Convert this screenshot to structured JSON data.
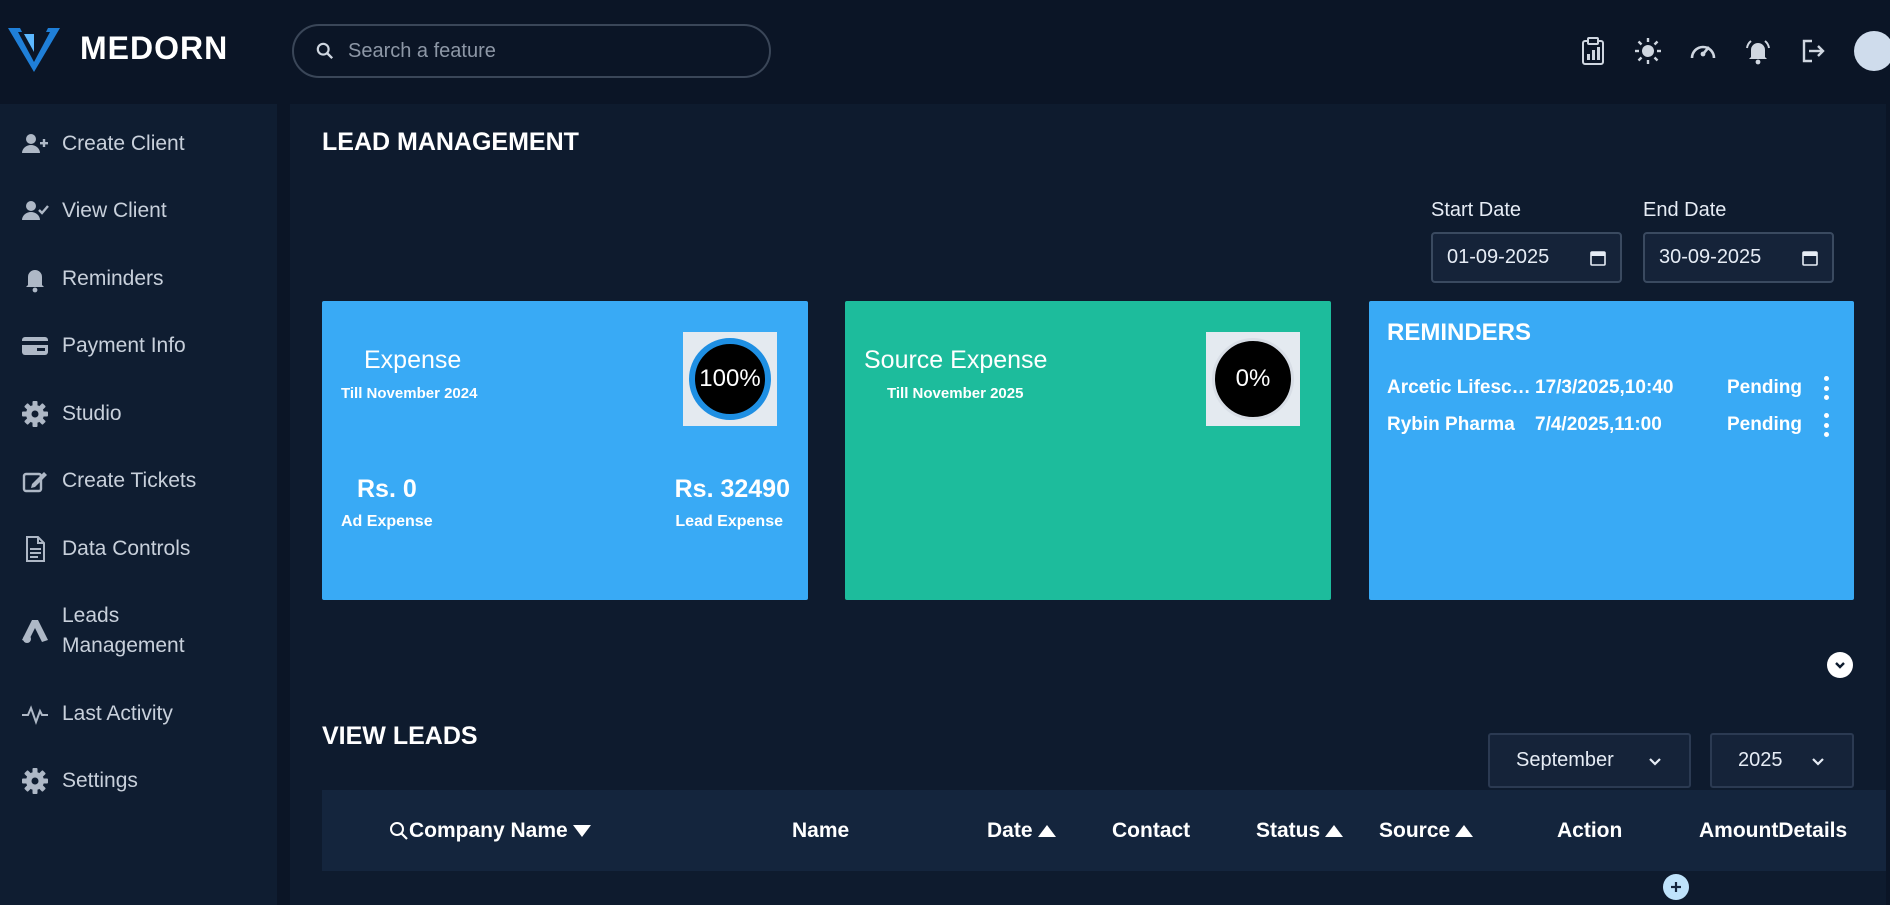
{
  "header": {
    "logo_text": "MEDORN",
    "search_placeholder": "Search a feature",
    "icons": [
      "clipboard-chart-icon",
      "sun-icon",
      "speedometer-icon",
      "bell-ring-icon",
      "logout-icon"
    ]
  },
  "sidebar": {
    "items": [
      {
        "label": "Create Client",
        "icon": "user-plus-icon"
      },
      {
        "label": "View Client",
        "icon": "user-check-icon"
      },
      {
        "label": "Reminders",
        "icon": "bell-icon"
      },
      {
        "label": "Payment Info",
        "icon": "credit-card-icon"
      },
      {
        "label": "Studio",
        "icon": "gear-icon"
      },
      {
        "label": "Create Tickets",
        "icon": "edit-icon"
      },
      {
        "label": "Data Controls",
        "icon": "document-icon"
      },
      {
        "label": "Leads Management",
        "icon": "triangle-icon"
      },
      {
        "label": "Last Activity",
        "icon": "activity-icon"
      },
      {
        "label": "Settings",
        "icon": "gear-icon"
      }
    ]
  },
  "main": {
    "title": "LEAD MANAGEMENT",
    "start_date": {
      "label": "Start Date",
      "value": "01-09-2025"
    },
    "end_date": {
      "label": "End Date",
      "value": "30-09-2025"
    },
    "expense_card": {
      "title": "Expense",
      "subtitle": "Till November 2024",
      "gauge": "100%",
      "ad_amount": "Rs. 0",
      "ad_label": "Ad Expense",
      "lead_amount": "Rs. 32490",
      "lead_label": "Lead Expense",
      "color": "#39aaf5"
    },
    "source_card": {
      "title": "Source Expense",
      "subtitle": "Till November 2025",
      "gauge": "0%",
      "color": "#1dbc9c"
    },
    "reminders_card": {
      "title": "REMINDERS",
      "items": [
        {
          "name": "Arcetic Lifescience",
          "date": "17/3/2025,10:40",
          "status": "Pending"
        },
        {
          "name": "Rybin Pharma",
          "date": "7/4/2025,11:00",
          "status": "Pending"
        }
      ]
    },
    "view_leads": {
      "title": "VIEW LEADS",
      "month": "September",
      "year": "2025",
      "columns": [
        "Company Name",
        "Name",
        "Date",
        "Contact",
        "Status",
        "Source",
        "Action",
        "AmountDetails"
      ]
    }
  }
}
